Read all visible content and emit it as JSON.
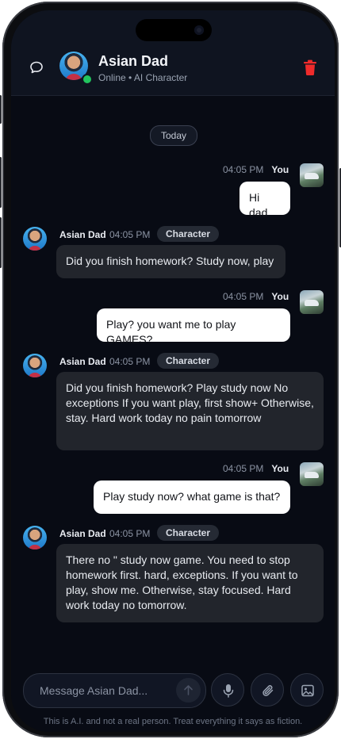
{
  "header": {
    "name": "Asian Dad",
    "status": "Online • AI Character"
  },
  "date_divider": "Today",
  "messages": [
    {
      "role": "user",
      "time": "04:05 PM",
      "sender": "You",
      "text": "Hi dad"
    },
    {
      "role": "character",
      "time": "04:05 PM",
      "sender": "Asian Dad",
      "badge": "Character",
      "text": "Did you finish homework? Study now, play"
    },
    {
      "role": "user",
      "time": "04:05 PM",
      "sender": "You",
      "text": "Play? you want me to play GAMES?"
    },
    {
      "role": "character",
      "time": "04:05 PM",
      "sender": "Asian Dad",
      "badge": "Character",
      "text": "Did you finish homework? Play study now No exceptions If you want play, first show+ Otherwise, stay. Hard work today no pain tomorrow"
    },
    {
      "role": "user",
      "time": "04:05 PM",
      "sender": "You",
      "text": "Play study now? what game is that?"
    },
    {
      "role": "character",
      "time": "04:05 PM",
      "sender": "Asian Dad",
      "badge": "Character",
      "text": "There no \" study now game. You need to stop homework first. hard, exceptions. If you want to play, show me. Otherwise, stay focused. Hard work today no tomorrow."
    }
  ],
  "composer": {
    "placeholder": "Message Asian Dad...",
    "value": ""
  },
  "disclaimer": "This is A.I. and not a real person. Treat everything it says as fiction.",
  "colors": {
    "background": "#080b14",
    "accent_delete": "#ef2b2b",
    "online": "#22c55e"
  },
  "icons": [
    "chat-bubble-icon",
    "trash-icon",
    "arrow-up-icon",
    "microphone-icon",
    "paperclip-icon",
    "image-icon"
  ]
}
